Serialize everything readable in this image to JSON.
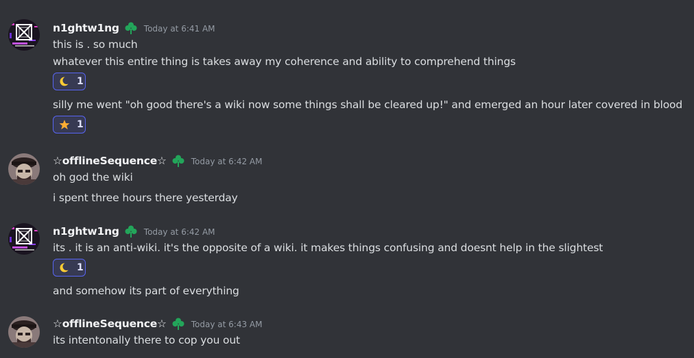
{
  "messages": [
    {
      "username": "n1ghtw1ng",
      "timestamp": "Today at 6:41 AM",
      "lines": [
        "this is . so much",
        "whatever this entire thing is takes away my coherence and ability to comprehend things",
        "silly me went \"oh good there's a wiki now some things shall be cleared up!\" and emerged an hour later covered in blood"
      ],
      "reactions": [
        {
          "emoji": "crescent-moon",
          "count": "1"
        },
        {
          "emoji": "star",
          "count": "1"
        }
      ]
    },
    {
      "username": "☆offlineSequence☆",
      "timestamp": "Today at 6:42 AM",
      "lines": [
        "oh god the wiki",
        "i spent three hours there yesterday"
      ]
    },
    {
      "username": "n1ghtw1ng",
      "timestamp": "Today at 6:42 AM",
      "lines": [
        "its . it is an anti-wiki. it's the opposite of a wiki. it makes things confusing and doesnt help in the slightest",
        "and somehow its part of everything"
      ],
      "reactions": [
        {
          "emoji": "crescent-moon",
          "count": "1"
        }
      ]
    },
    {
      "username": "☆offlineSequence☆",
      "timestamp": "Today at 6:43 AM",
      "lines": [
        "its intentonally there to cop you out"
      ]
    }
  ],
  "colors": {
    "background": "#313338",
    "username": "#f2f3f5",
    "text": "#dbdee1",
    "timestamp": "#949ba4",
    "role_icon": "#23a55a",
    "reaction_border": "#5865f2",
    "reaction_bg": "#373a53"
  }
}
